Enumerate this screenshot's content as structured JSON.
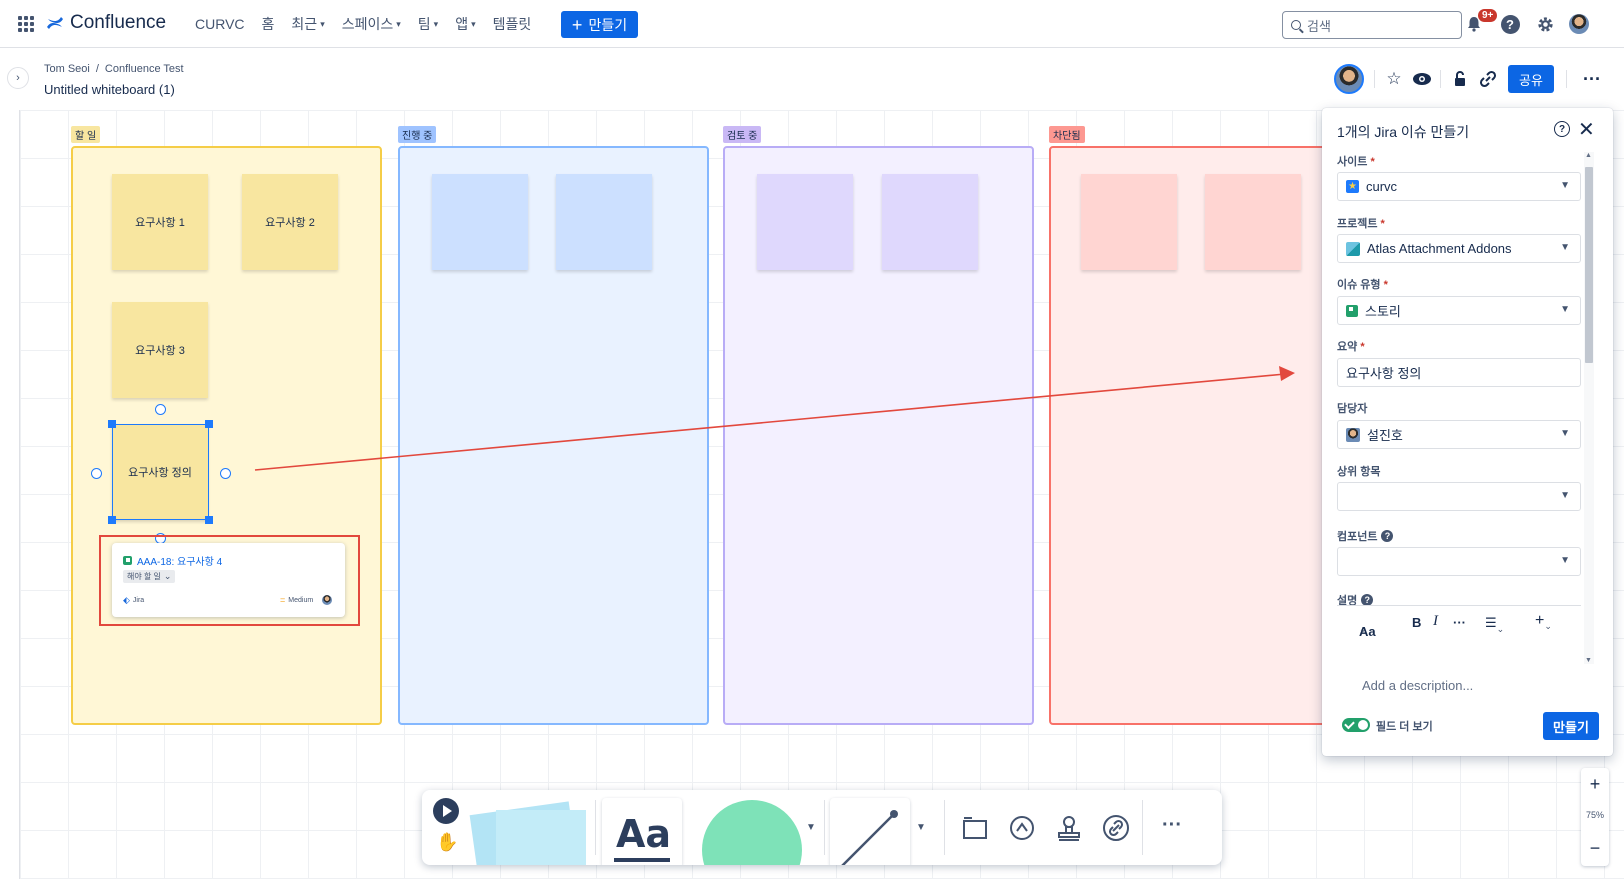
{
  "topnav": {
    "logo": "Confluence",
    "items": [
      {
        "label": "CURVC",
        "caret": false
      },
      {
        "label": "홈",
        "caret": false
      },
      {
        "label": "최근",
        "caret": true
      },
      {
        "label": "스페이스",
        "caret": true
      },
      {
        "label": "팀",
        "caret": true
      },
      {
        "label": "앱",
        "caret": true
      },
      {
        "label": "템플릿",
        "caret": false
      }
    ],
    "create_label": "만들기",
    "search_placeholder": "검색",
    "notification_badge": "9+"
  },
  "breadcrumb": [
    "Tom Seoi",
    "Confluence Test"
  ],
  "breadcrumb_sep": "/",
  "page_title": "Untitled whiteboard (1)",
  "header": {
    "share_label": "공유"
  },
  "columns": [
    {
      "label": "할 일",
      "color": "#f8e6a0",
      "border": "#f5cd47",
      "bg": "#fff7d6"
    },
    {
      "label": "진행 중",
      "color": "#9fc3ff",
      "border": "#85b8ff",
      "bg": "#e9f2ff"
    },
    {
      "label": "검토 중",
      "color": "#c9b8f5",
      "border": "#b8acf6",
      "bg": "#f3f0ff"
    },
    {
      "label": "차단됨",
      "color": "#fd9891",
      "border": "#f87168",
      "bg": "#ffeceb"
    }
  ],
  "stickies": {
    "todo": [
      "요구사항 1",
      "요구사항 2",
      "요구사항 3"
    ],
    "selected": "요구사항 정의"
  },
  "jira_card": {
    "key_title": "AAA-18: 요구사항 4",
    "status": "해야 할 일",
    "source": "Jira",
    "priority": "Medium"
  },
  "panel": {
    "title": "1개의 Jira 이슈 만들기",
    "fields": {
      "site": {
        "label": "사이트",
        "value": "curvc"
      },
      "project": {
        "label": "프로젝트",
        "value": "Atlas Attachment Addons"
      },
      "issue_type": {
        "label": "이슈 유형",
        "value": "스토리"
      },
      "summary": {
        "label": "요약",
        "value": "요구사항 정의"
      },
      "assignee": {
        "label": "담당자",
        "value": "설진호"
      },
      "parent": {
        "label": "상위 항목",
        "value": ""
      },
      "component": {
        "label": "컴포넌트",
        "value": ""
      },
      "description": {
        "label": "설명",
        "placeholder": "Add a description..."
      }
    },
    "required_mark": "*",
    "editor": {
      "text_style": "Aa",
      "bold": "B",
      "italic": "I",
      "more": "···"
    },
    "toggle_label": "필드 더 보기",
    "create_label": "만들기"
  },
  "zoom": {
    "plus": "+",
    "level": "75%",
    "minus": "−"
  },
  "toolbar": {
    "text_tool": "Aa",
    "more": "···"
  },
  "colors": {
    "brand_blue": "#0c66e4",
    "annotation_red": "#e2483d",
    "selection_blue": "#1d7afc"
  }
}
